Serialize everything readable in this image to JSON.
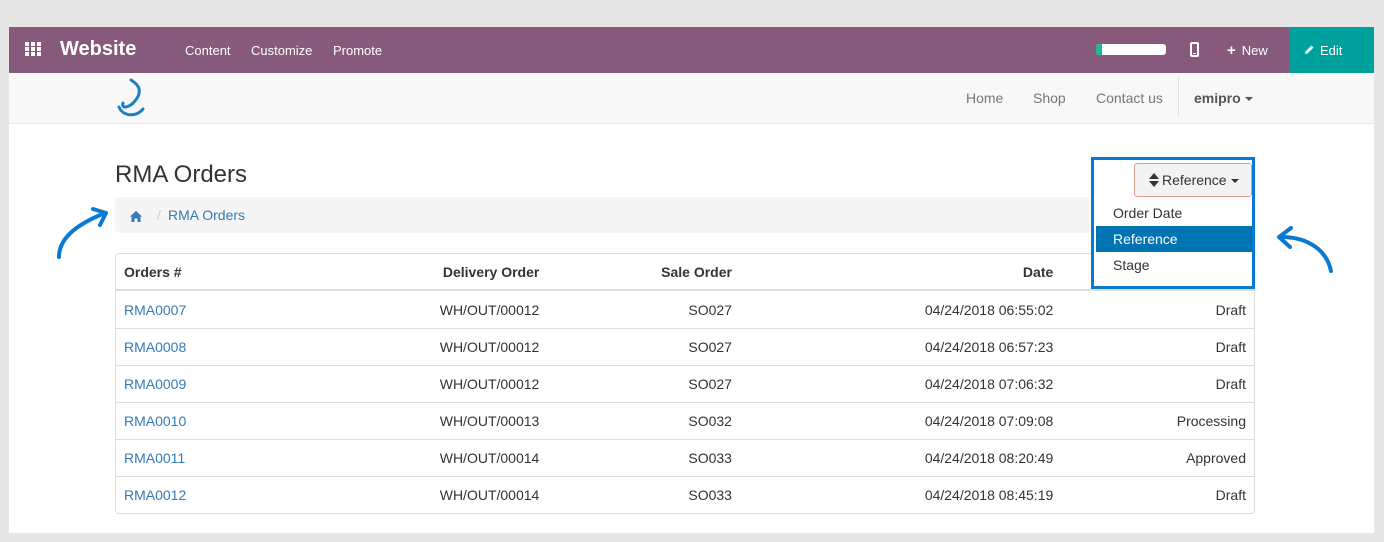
{
  "topbar": {
    "brand": "Website",
    "menu": [
      "Content",
      "Customize",
      "Promote"
    ],
    "progress": 0.08,
    "new_label": "New",
    "edit_label": "Edit"
  },
  "nav": {
    "links": [
      "Home",
      "Shop",
      "Contact us"
    ],
    "user": "emipro"
  },
  "page": {
    "title": "RMA Orders",
    "breadcrumb": "RMA Orders"
  },
  "sort": {
    "button_label": "Reference",
    "options": [
      "Order Date",
      "Reference",
      "Stage"
    ],
    "selected": "Reference"
  },
  "table": {
    "headers": [
      "Orders #",
      "Delivery Order",
      "Sale Order",
      "Date",
      ""
    ],
    "rows": [
      [
        "RMA0007",
        "WH/OUT/00012",
        "SO027",
        "04/24/2018 06:55:02",
        "Draft"
      ],
      [
        "RMA0008",
        "WH/OUT/00012",
        "SO027",
        "04/24/2018 06:57:23",
        "Draft"
      ],
      [
        "RMA0009",
        "WH/OUT/00012",
        "SO027",
        "04/24/2018 07:06:32",
        "Draft"
      ],
      [
        "RMA0010",
        "WH/OUT/00013",
        "SO032",
        "04/24/2018 07:09:08",
        "Processing"
      ],
      [
        "RMA0011",
        "WH/OUT/00014",
        "SO033",
        "04/24/2018 08:20:49",
        "Approved"
      ],
      [
        "RMA0012",
        "WH/OUT/00014",
        "SO033",
        "04/24/2018 08:45:19",
        "Draft"
      ]
    ]
  },
  "colors": {
    "topbar": "#875a7b",
    "edit": "#00a09d",
    "link": "#337ab7",
    "highlight": "#0a7ad1",
    "active": "#0073b3"
  }
}
